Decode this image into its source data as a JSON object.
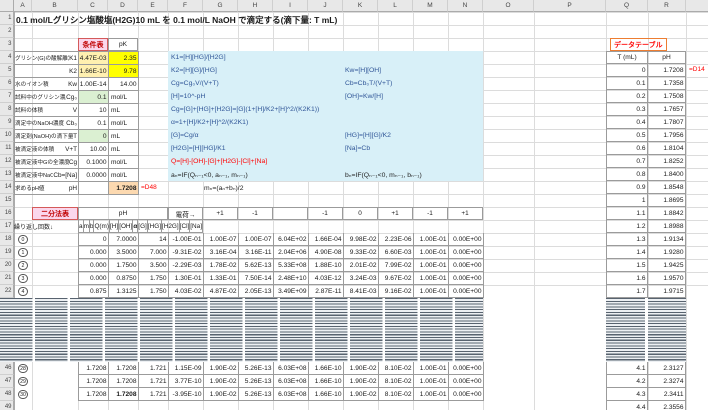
{
  "title_cell": "0.1 mol/Lグリシン塩酸塩(H2G)10 mL を 0.1 mol/L NaOH で滴定する(滴下量: T mL)",
  "grid": {
    "column_letters": [
      "A",
      "B",
      "C",
      "D",
      "E",
      "F",
      "G",
      "H",
      "I",
      "J",
      "K",
      "L",
      "M",
      "N",
      "O",
      "P",
      "Q",
      "R"
    ],
    "row_numbers_top": [
      "1",
      "2",
      "3",
      "4",
      "5",
      "6",
      "7",
      "8",
      "9",
      "10",
      "11",
      "12",
      "13",
      "14",
      "15",
      "16",
      "17",
      "18",
      "19",
      "20",
      "21",
      "22"
    ],
    "row_numbers_bottom": [
      "46",
      "47",
      "48",
      "49"
    ]
  },
  "condition_table": {
    "header_label": "条件表",
    "pk_header": "pK",
    "rows": [
      {
        "label": "グリシン(G)の酸解離定数",
        "symbol": "K1",
        "value": "4.47E-03",
        "unit": "2.35"
      },
      {
        "label": "",
        "symbol": "K2",
        "value": "1.66E-10",
        "unit": "9.78"
      },
      {
        "label": "水のイオン積",
        "symbol": "Kw",
        "value": "1.00E-14",
        "unit": "14.00"
      },
      {
        "label": "試料中のグリシン濃度",
        "symbol": "Cg₀",
        "value": "0.1",
        "unit": "mol/L"
      },
      {
        "label": "試料の体積",
        "symbol": "V",
        "value": "10",
        "unit": "mL"
      },
      {
        "label": "滴定中のNaOH濃度",
        "symbol": "Cb₀",
        "value": "0.1",
        "unit": "mol/L"
      },
      {
        "label": "滴定剤(NaOH)の滴下量",
        "symbol": "T",
        "value": "0",
        "unit": "mL"
      },
      {
        "label": "被滴定液の体積",
        "symbol": "V+T",
        "value": "10.00",
        "unit": "mL"
      },
      {
        "label": "被滴定液中Gの全濃度",
        "symbol": "Cg",
        "value": "0.1000",
        "unit": "mol/L"
      },
      {
        "label": "被滴定液中NaOHの全濃度",
        "symbol": "Cb=[Na]",
        "value": "0.0000",
        "unit": "mol/L"
      },
      {
        "label": "求めるpH値",
        "symbol": "pH",
        "value": "",
        "unit": "1.7208"
      }
    ],
    "ph_formula_note": "=D48"
  },
  "formulas": {
    "rows": [
      {
        "left": "K1=[H][HG]/[H2G]",
        "right": ""
      },
      {
        "left": "K2=[H][G]/[HG]",
        "right": "Kw=[H][OH]"
      },
      {
        "left": "Cg=Cg₀V/(V+T)",
        "right": "Cb=Cb₀T/(V+T)"
      },
      {
        "left": "[H]=10^-pH",
        "right": "[OH]=Kw/[H]"
      },
      {
        "left": "Cg=[G]+[HG]+[H2G]=[G](1+[H]/K2+[H]^2/(K2K1))",
        "right": ""
      },
      {
        "left": "α=1+[H]/K2+[H]^2/(K2K1)",
        "right": ""
      },
      {
        "left": "[G]=Cg/α",
        "right": "[HG]=[H][G]/K2"
      },
      {
        "left": "[H2G]=[H][HG]/K1",
        "right": "[Na]=Cb"
      },
      {
        "left": "Q=[H]-[OH]-[G]+[H2G]-[Cl]+[Na]",
        "right": ""
      },
      {
        "left": "aₙ=IF(Qₙ₋₁<0, aₙ₋₁, mₙ₋₁)",
        "right": "bₙ=IF(Qₙ₋₁<0, mₙ₋₁, bₙ₋₁)"
      }
    ],
    "m_formula": "mₙ=(aₙ+bₙ)/2"
  },
  "bisection": {
    "section_label": "二分法表",
    "ph_span_header": "pH",
    "charge_row_label": "電荷→",
    "charges": [
      "+1",
      "-1",
      "",
      "-1",
      "0",
      "+1",
      "-1",
      "+1"
    ],
    "iteration_label": "繰り返し回数↓",
    "column_headers": [
      "a",
      "m",
      "b",
      "Q(m)",
      "[H]",
      "[OH]",
      "α",
      "[G]",
      "[HG]",
      "[H2G]",
      "[Cl]",
      "[Na]"
    ],
    "rows_top": [
      {
        "n": "0",
        "a": "0",
        "m": "7.0000",
        "b": "14",
        "qm": "-1.00E-01",
        "h": "1.00E-07",
        "oh": "1.00E-07",
        "alpha": "6.04E+02",
        "g": "1.66E-04",
        "hg": "9.98E-02",
        "h2g": "2.23E-06",
        "cl": "1.00E-01",
        "na": "0.00E+00"
      },
      {
        "n": "1",
        "a": "0.000",
        "m": "3.5000",
        "b": "7.000",
        "qm": "-9.31E-02",
        "h": "3.16E-04",
        "oh": "3.16E-11",
        "alpha": "2.04E+06",
        "g": "4.90E-08",
        "hg": "9.33E-02",
        "h2g": "6.60E-03",
        "cl": "1.00E-01",
        "na": "0.00E+00"
      },
      {
        "n": "2",
        "a": "0.000",
        "m": "1.7500",
        "b": "3.500",
        "qm": "-2.29E-03",
        "h": "1.78E-02",
        "oh": "5.62E-13",
        "alpha": "5.33E+08",
        "g": "1.88E-10",
        "hg": "2.01E-02",
        "h2g": "7.99E-02",
        "cl": "1.00E-01",
        "na": "0.00E+00"
      },
      {
        "n": "3",
        "a": "0.000",
        "m": "0.8750",
        "b": "1.750",
        "qm": "1.30E-01",
        "h": "1.33E-01",
        "oh": "7.50E-14",
        "alpha": "2.48E+10",
        "g": "4.03E-12",
        "hg": "3.24E-03",
        "h2g": "9.67E-02",
        "cl": "1.00E-01",
        "na": "0.00E+00"
      },
      {
        "n": "4",
        "a": "0.875",
        "m": "1.3125",
        "b": "1.750",
        "qm": "4.03E-02",
        "h": "4.87E-02",
        "oh": "2.05E-13",
        "alpha": "3.49E+09",
        "g": "2.87E-11",
        "hg": "8.41E-03",
        "h2g": "9.16E-02",
        "cl": "1.00E-01",
        "na": "0.00E+00"
      }
    ],
    "rows_bottom": [
      {
        "n": "28",
        "a": "1.7208",
        "m": "1.7208",
        "b": "1.721",
        "qm": "1.15E-09",
        "h": "1.90E-02",
        "oh": "5.26E-13",
        "alpha": "6.03E+08",
        "g": "1.66E-10",
        "hg": "1.90E-02",
        "h2g": "8.10E-02",
        "cl": "1.00E-01",
        "na": "0.00E+00"
      },
      {
        "n": "29",
        "a": "1.7208",
        "m": "1.7208",
        "b": "1.721",
        "qm": "3.77E-10",
        "h": "1.90E-02",
        "oh": "5.26E-13",
        "alpha": "6.03E+08",
        "g": "1.66E-10",
        "hg": "1.90E-02",
        "h2g": "8.10E-02",
        "cl": "1.00E-01",
        "na": "0.00E+00"
      },
      {
        "n": "30",
        "a": "1.7208",
        "m": "1.7208",
        "b": "1.721",
        "qm": "-3.95E-10",
        "h": "1.90E-02",
        "oh": "5.26E-13",
        "alpha": "6.03E+08",
        "g": "1.66E-10",
        "hg": "1.90E-02",
        "h2g": "8.10E-02",
        "cl": "1.00E-01",
        "na": "0.00E+00"
      }
    ]
  },
  "data_table": {
    "section_label": "データテーブル",
    "col_t": "T (mL)",
    "col_ph": "pH",
    "first_cell_note": "=D14",
    "rows_top": [
      {
        "t": "0",
        "ph": "1.7208"
      },
      {
        "t": "0.1",
        "ph": "1.7358"
      },
      {
        "t": "0.2",
        "ph": "1.7508"
      },
      {
        "t": "0.3",
        "ph": "1.7657"
      },
      {
        "t": "0.4",
        "ph": "1.7807"
      },
      {
        "t": "0.5",
        "ph": "1.7956"
      },
      {
        "t": "0.6",
        "ph": "1.8104"
      },
      {
        "t": "0.7",
        "ph": "1.8252"
      },
      {
        "t": "0.8",
        "ph": "1.8400"
      },
      {
        "t": "0.9",
        "ph": "1.8548"
      },
      {
        "t": "1",
        "ph": "1.8695"
      },
      {
        "t": "1.1",
        "ph": "1.8842"
      },
      {
        "t": "1.2",
        "ph": "1.8988"
      },
      {
        "t": "1.3",
        "ph": "1.9134"
      },
      {
        "t": "1.4",
        "ph": "1.9280"
      },
      {
        "t": "1.5",
        "ph": "1.9425"
      },
      {
        "t": "1.6",
        "ph": "1.9570"
      },
      {
        "t": "1.7",
        "ph": "1.9715"
      }
    ],
    "rows_bottom": [
      {
        "t": "4.1",
        "ph": "2.3127"
      },
      {
        "t": "4.2",
        "ph": "2.3274"
      },
      {
        "t": "4.3",
        "ph": "2.3411"
      },
      {
        "t": "4.4",
        "ph": "2.3556"
      }
    ]
  },
  "colors": {
    "formula_text_blue": "#2F5597",
    "annotation_red": "#FF0000",
    "highlight_yellow": "#FFFF00",
    "highlight_pale_yellow": "#FFF0B0",
    "highlight_green": "#DBF0D2",
    "highlight_orange": "#FCD9B0",
    "formula_block_cyan": "#D8F0F8",
    "section_label_pink_bg": "#FBD7EC",
    "section_label_pink_border": "#D45A5A",
    "section_label_red": "#C00000",
    "data_table_box_orange": "#ED7D31"
  }
}
